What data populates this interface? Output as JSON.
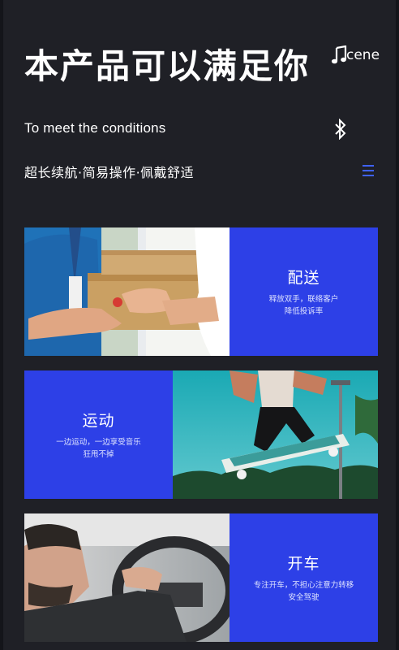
{
  "header": {
    "headline": "本产品可以满足你",
    "scene_label": "cene",
    "subtitle": "To meet the conditions",
    "features": "超长续航·简易操作·佩戴舒适"
  },
  "icons": {
    "scene": "music-note-icon",
    "bluetooth": "bluetooth-icon",
    "menu": "menu-icon"
  },
  "colors": {
    "background": "#1f2026",
    "accent": "#2d40e7"
  },
  "scenes": [
    {
      "title": "配送",
      "lines": [
        "释放双手，联络客户",
        "降低投诉率"
      ],
      "image": "delivery-photo"
    },
    {
      "title": "运动",
      "lines": [
        "一边运动，一边享受音乐",
        "狂甩不掉"
      ],
      "image": "skateboard-photo"
    },
    {
      "title": "开车",
      "lines": [
        "专注开车，不担心注意力转移",
        "安全驾驶"
      ],
      "image": "driving-photo"
    }
  ]
}
